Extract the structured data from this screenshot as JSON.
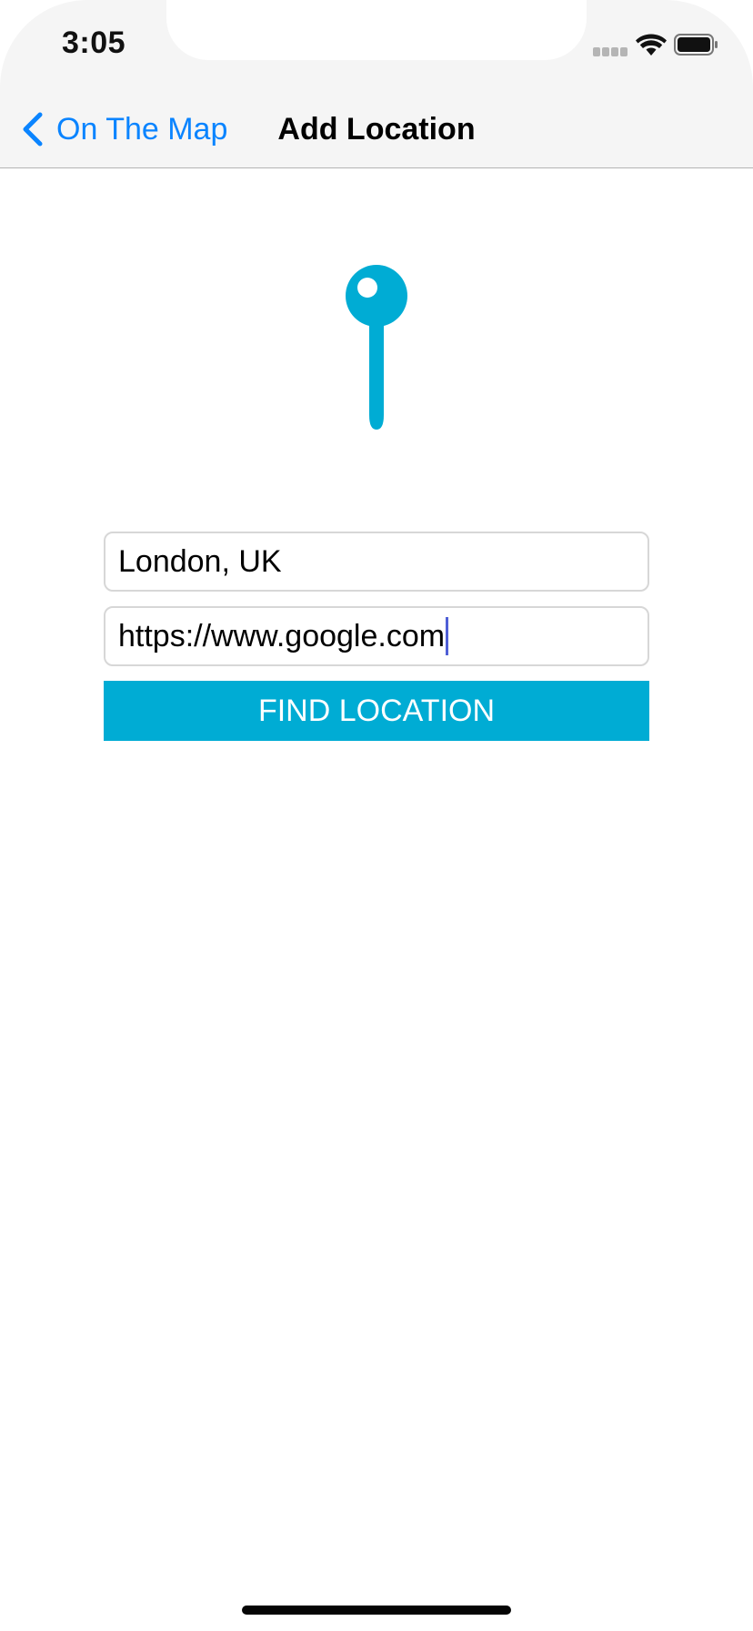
{
  "status_bar": {
    "time": "3:05"
  },
  "nav_bar": {
    "back_label": "On The Map",
    "title": "Add Location"
  },
  "form": {
    "location_value": "London, UK",
    "link_value": "https://www.google.com",
    "find_button_label": "FIND LOCATION"
  },
  "icons": {
    "back": "chevron-left-icon",
    "pin": "map-pin-icon",
    "signal": "cellular-signal-icon",
    "wifi": "wifi-icon",
    "battery": "battery-icon"
  },
  "colors": {
    "accent_blue": "#0a84ff",
    "brand_teal": "#00acd4",
    "caret": "#4f5fd6"
  }
}
